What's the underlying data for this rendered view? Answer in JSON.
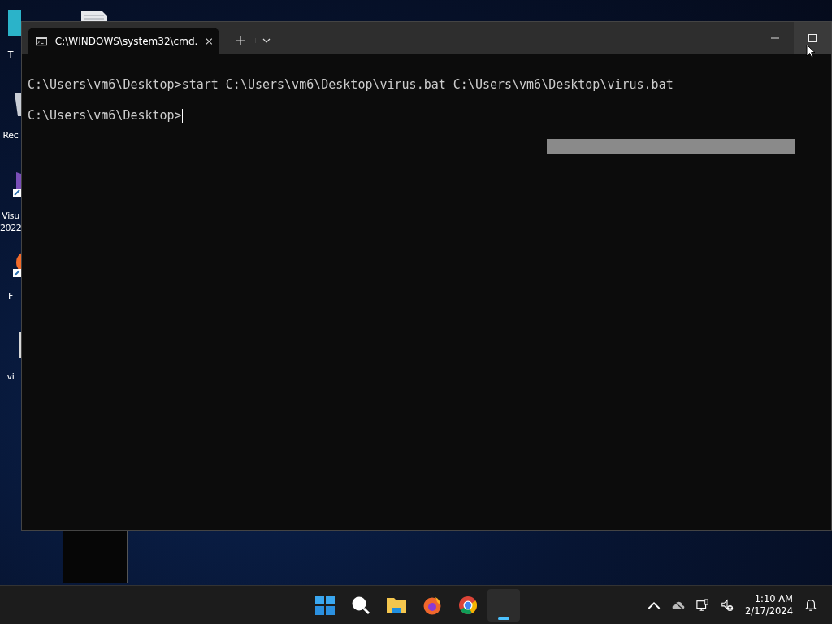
{
  "desktop_icons": [
    {
      "kind": "folder",
      "label": "T"
    },
    {
      "kind": "recycle",
      "label": "Rec"
    },
    {
      "kind": "studio",
      "label": "Visu 2022"
    },
    {
      "kind": "firefox",
      "label": "F"
    },
    {
      "kind": "file",
      "label": "vi"
    }
  ],
  "window": {
    "tab": {
      "title": "C:\\WINDOWS\\system32\\cmd.",
      "selected": true
    },
    "terminal_lines": [
      "C:\\Users\\vm6\\Desktop>start C:\\Users\\vm6\\Desktop\\virus.bat C:\\Users\\vm6\\Desktop\\virus.bat",
      "C:\\Users\\vm6\\Desktop>"
    ]
  },
  "taskbar": {
    "apps": [
      {
        "kind": "start",
        "selected": false
      },
      {
        "kind": "search",
        "selected": false
      },
      {
        "kind": "explorer",
        "selected": false
      },
      {
        "kind": "firefox",
        "selected": false
      },
      {
        "kind": "chrome",
        "selected": false
      },
      {
        "kind": "terminal",
        "selected": true
      }
    ],
    "time": "1:10 AM",
    "date": "2/17/2024"
  }
}
